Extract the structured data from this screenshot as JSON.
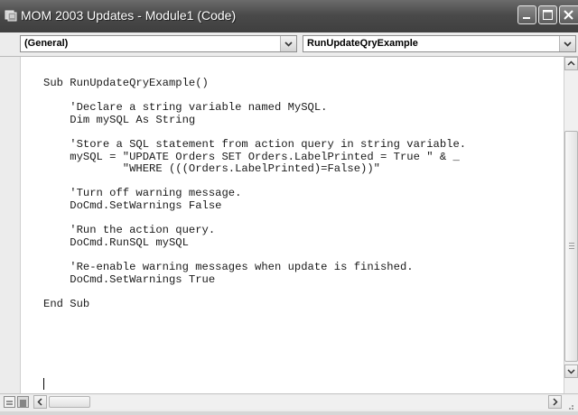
{
  "window": {
    "title": "MOM 2003 Updates - Module1 (Code)",
    "icon": "module-code-icon"
  },
  "title_buttons": [
    "minimize",
    "maximize",
    "close"
  ],
  "procedure_bar": {
    "object_combo": "(General)",
    "procedure_combo": "RunUpdateQryExample"
  },
  "code_lines": [
    "Sub RunUpdateQryExample()",
    "",
    "    'Declare a string variable named MySQL.",
    "    Dim mySQL As String",
    "",
    "    'Store a SQL statement from action query in string variable.",
    "    mySQL = \"UPDATE Orders SET Orders.LabelPrinted = True \" & _",
    "            \"WHERE (((Orders.LabelPrinted)=False))\"",
    "",
    "    'Turn off warning message.",
    "    DoCmd.SetWarnings False",
    "",
    "    'Run the action query.",
    "    DoCmd.RunSQL mySQL",
    "",
    "    'Re-enable warning messages when update is finished.",
    "    DoCmd.SetWarnings True",
    "",
    "End Sub"
  ],
  "colors": {
    "titlebar": "#4a4a4a",
    "code_background": "#ffffff",
    "code_text": "#1a1a1a"
  }
}
